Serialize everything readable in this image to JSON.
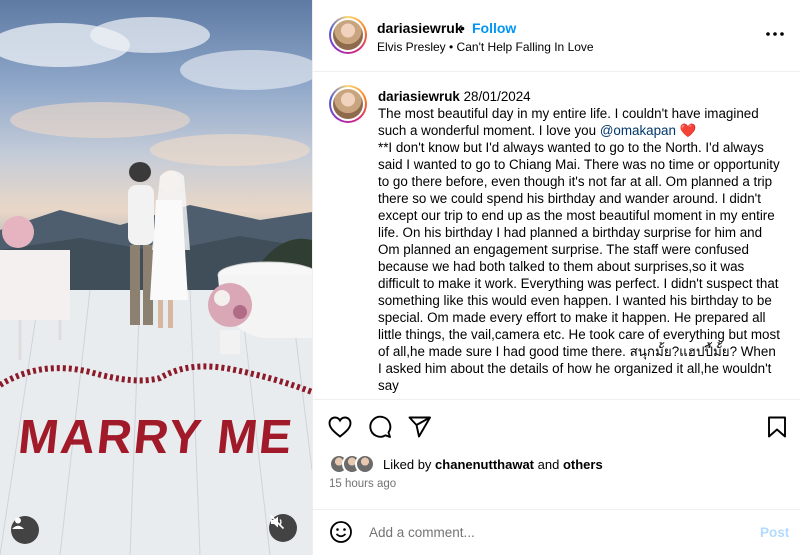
{
  "header": {
    "username": "dariasiewruk",
    "separator": "•",
    "follow_label": "Follow",
    "music": "Elvis Presley • Can't Help Falling In Love"
  },
  "caption": {
    "username": "dariasiewruk",
    "date": "28/01/2024",
    "line_part1": "The most beautiful day in my entire life. I couldn't have imagined such a wonderful moment. I love you ",
    "mention": "@omakapan",
    "heart": "❤️",
    "body": "**I don't know but I'd always wanted to go to the North. I'd always said I wanted to go to Chiang Mai. There was no time or opportunity to go there before, even though it's not far at all. Om planned a trip there so we could spend his birthday and wander around. I didn't except our trip to end up as the most beautiful moment in my entire life. On his birthday I had planned a birthday surprise for him and Om planned an engagement surprise. The staff were confused because we had both talked to them about surprises,so it was difficult to make it work. Everything was perfect. I didn't suspect that something like this would even happen. I wanted his birthday to be special. Om made every effort to make it happen. He prepared all little things, the vail,camera etc. He took care of everything but most of all,he made sure I had good time there. สนุกมั้ย?แฮปปี้มั้ย? When I asked him about the details of how he organized it all,he wouldn't say"
  },
  "media": {
    "petal_text": "MARRY ME"
  },
  "actions": {
    "like_icon": "heart-outline-icon",
    "comment_icon": "speech-bubble-icon",
    "share_icon": "paper-plane-icon",
    "save_icon": "bookmark-icon"
  },
  "likes": {
    "prefix": "Liked by ",
    "user": "chanenutthawat",
    "middle": " and ",
    "others": "others"
  },
  "timestamp": "15 hours ago",
  "comment": {
    "placeholder": "Add a comment...",
    "post_label": "Post"
  },
  "colors": {
    "follow": "#0095f6",
    "mention": "#00376b",
    "heart": "#ed4956",
    "post_disabled": "#b3dbff",
    "muted_text": "#737373"
  }
}
